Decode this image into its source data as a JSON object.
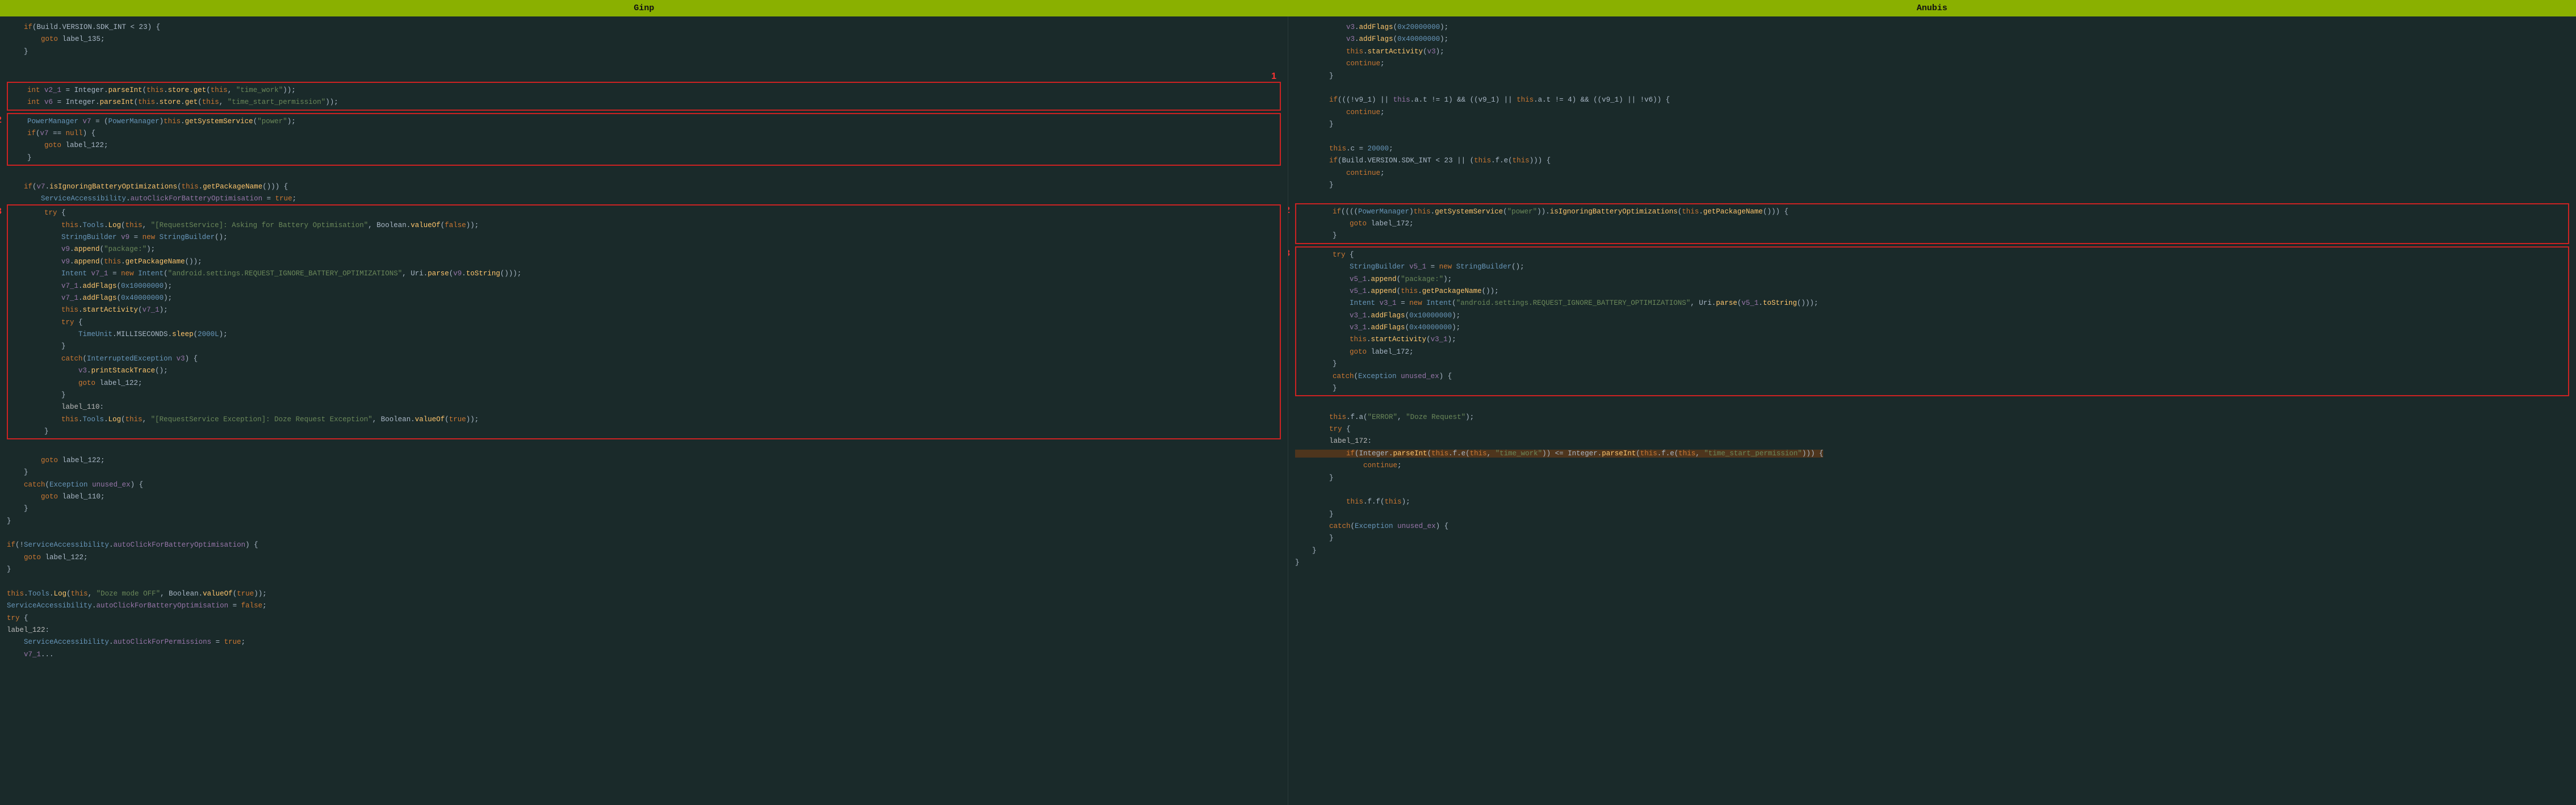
{
  "headers": {
    "left": "Ginp",
    "right": "Anubis"
  },
  "left_panel": {
    "title": "Ginp"
  },
  "right_panel": {
    "title": "Anubis"
  }
}
